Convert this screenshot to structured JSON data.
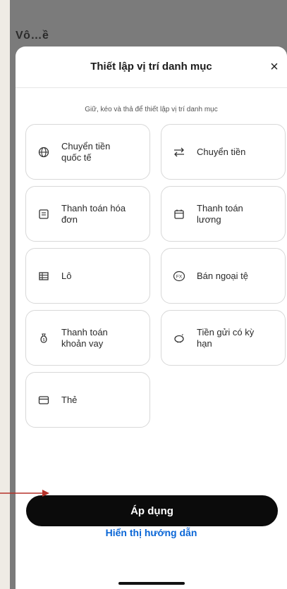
{
  "background": {
    "title": "Vô…ề"
  },
  "sheet": {
    "title": "Thiết lập vị trí danh mục",
    "close": "×",
    "hint": "Giữ, kéo và thả để thiết lập vị trí danh mục"
  },
  "tiles": [
    {
      "label": "Chuyển tiền quốc tế",
      "icon": "globe-icon"
    },
    {
      "label": "Chuyển tiền",
      "icon": "transfer-arrows-icon"
    },
    {
      "label": "Thanh toán hóa đơn",
      "icon": "bill-icon"
    },
    {
      "label": "Thanh toán lương",
      "icon": "calendar-icon"
    },
    {
      "label": "Lô",
      "icon": "table-icon"
    },
    {
      "label": "Bán ngoại tệ",
      "icon": "fx-icon"
    },
    {
      "label": "Thanh toán khoản vay",
      "icon": "money-bag-icon"
    },
    {
      "label": "Tiền gửi có kỳ hạn",
      "icon": "piggy-bank-icon"
    },
    {
      "label": "Thẻ",
      "icon": "card-icon"
    }
  ],
  "actions": {
    "apply": "Áp dụng",
    "guide": "Hiển thị hướng dẫn"
  },
  "colors": {
    "accent": "#0a66d6",
    "primary_button": "#0b0b0b",
    "annotation_arrow": "#b5322b"
  }
}
